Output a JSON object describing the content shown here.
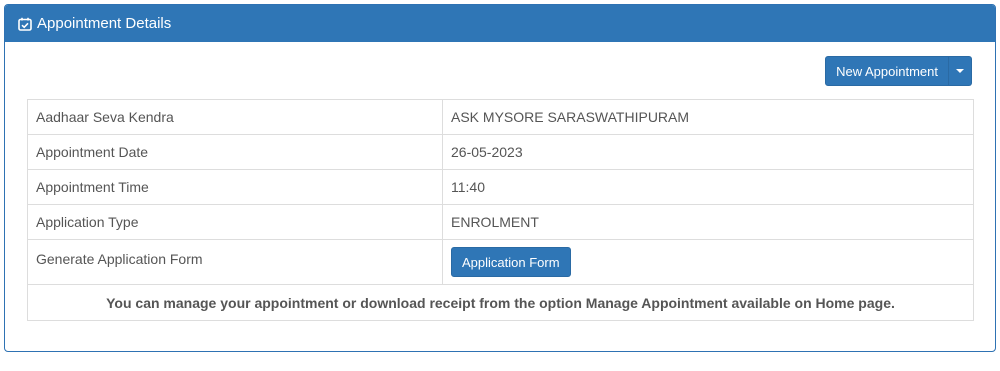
{
  "panel": {
    "title": "Appointment Details",
    "icon": "calendar-check-icon"
  },
  "toolbar": {
    "new_appointment_label": "New Appointment"
  },
  "details": {
    "rows": [
      {
        "label": "Aadhaar Seva Kendra",
        "value": "ASK MYSORE SARASWATHIPURAM"
      },
      {
        "label": "Appointment Date",
        "value": "26-05-2023"
      },
      {
        "label": "Appointment Time",
        "value": "11:40"
      },
      {
        "label": "Application Type",
        "value": "ENROLMENT"
      }
    ],
    "form_row": {
      "label": "Generate Application Form",
      "button_label": "Application Form"
    },
    "note": "You can manage your appointment or download receipt from the option Manage Appointment available on Home page."
  },
  "colors": {
    "primary": "#2f76b6",
    "border": "#dddddd",
    "text": "#555555"
  }
}
